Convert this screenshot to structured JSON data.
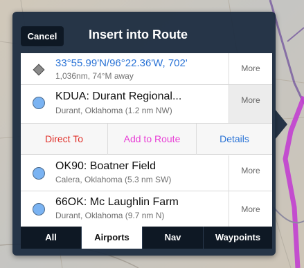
{
  "header": {
    "cancel_label": "Cancel",
    "title": "Insert into Route"
  },
  "rows": [
    {
      "icon": "diamond-icon",
      "title": "33°55.99'N/96°22.36'W, 702'",
      "subtitle": "1,036nm, 74°M away",
      "more_label": "More"
    },
    {
      "icon": "airport-circle-icon",
      "title": "KDUA: Durant Regional...",
      "subtitle": "Durant, Oklahoma  (1.2 nm NW)",
      "more_label": "More"
    },
    {
      "icon": "airport-circle-icon",
      "title": "OK90: Boatner Field",
      "subtitle": "Calera, Oklahoma  (5.3 nm SW)",
      "more_label": "More"
    },
    {
      "icon": "airport-circle-icon",
      "title": "66OK: Mc Laughlin Farm",
      "subtitle": "Durant, Oklahoma  (9.7 nm N)",
      "more_label": "More"
    }
  ],
  "actions": {
    "direct_to": "Direct To",
    "add_to_route": "Add to Route",
    "details": "Details"
  },
  "tabs": [
    {
      "label": "All",
      "selected": false
    },
    {
      "label": "Airports",
      "selected": true
    },
    {
      "label": "Nav",
      "selected": false
    },
    {
      "label": "Waypoints",
      "selected": false
    }
  ],
  "colors": {
    "coordinate_text": "#2a73d6",
    "direct_to": "#e0302a",
    "add_to_route": "#e83fd6",
    "details": "#2a73d6",
    "route_line": "#c23fd0",
    "airport_icon": "#7ab3f2"
  }
}
